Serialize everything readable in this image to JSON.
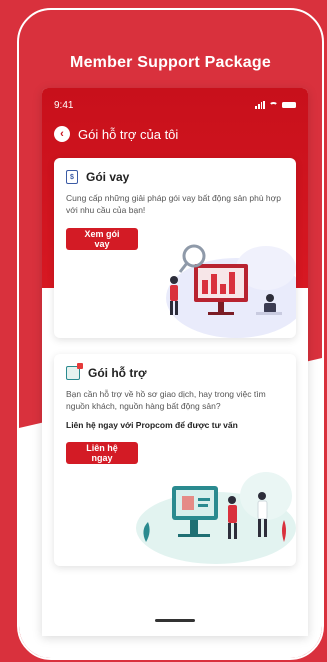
{
  "headline": "Member Support Package",
  "status": {
    "time": "9:41"
  },
  "nav": {
    "title": "Gói hỗ trợ của tôi"
  },
  "card_loan": {
    "title": "Gói vay",
    "icon_glyph": "$",
    "description": "Cung cấp những giải pháp gói vay bất động sản phù hợp với nhu cầu của bạn!",
    "button": "Xem gói vay"
  },
  "card_support": {
    "title": "Gói hỗ trợ",
    "description": "Bạn cần hỗ trợ về hồ sơ giao dịch, hay trong việc tìm nguồn khách, nguồn hàng bất động sản?",
    "highlight": "Liên hệ ngay với Propcom để được tư vấn",
    "button": "Liên hệ ngay"
  },
  "colors": {
    "brand": "#d9313d",
    "primary_button": "#d31b25",
    "header": "#c8101b"
  }
}
